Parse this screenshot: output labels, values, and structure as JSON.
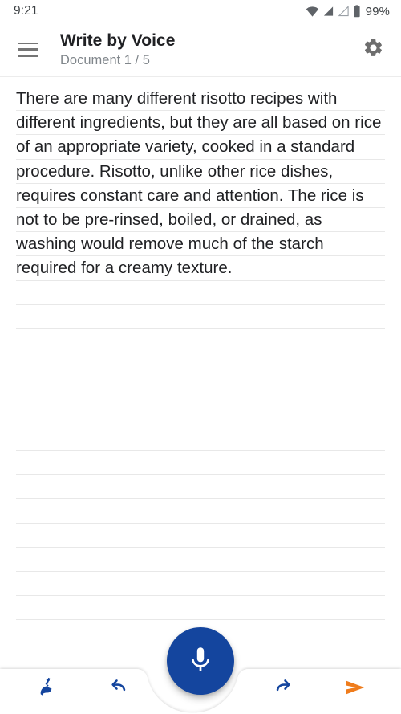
{
  "status_bar": {
    "time": "9:21",
    "battery_percent": "99%",
    "icons": [
      "wifi-icon",
      "signal-filled-icon",
      "signal-outline-icon",
      "battery-icon"
    ]
  },
  "app_bar": {
    "menu_icon": "hamburger-menu-icon",
    "title": "Write by Voice",
    "subtitle": "Document 1 / 5",
    "settings_icon": "gear-icon"
  },
  "document": {
    "text": "There are many different risotto recipes with different ingredients, but they are all based on rice of an appropriate variety, cooked in a standard procedure. Risotto, unlike other rice dishes, requires constant care and attention. The rice is not to be pre-rinsed, boiled, or drained, as washing would remove much of the starch required for a creamy texture.",
    "ruled_line_count": 22,
    "ruled_line_spacing": 30.2,
    "ruled_line_color": "#e8e8e8"
  },
  "bottom_bar": {
    "actions": [
      {
        "name": "clear-button",
        "icon": "broom-icon",
        "color": "#14459E"
      },
      {
        "name": "undo-button",
        "icon": "undo-arrow-icon",
        "color": "#14459E"
      },
      {
        "name": "redo-button",
        "icon": "redo-arrow-icon",
        "color": "#14459E"
      },
      {
        "name": "send-button",
        "icon": "send-arrow-icon",
        "color": "#EF7C1C"
      }
    ]
  },
  "fab": {
    "name": "record-voice-button",
    "icon": "microphone-icon",
    "background": "#14459E",
    "icon_color": "#ffffff"
  },
  "colors": {
    "primary_blue": "#14459E",
    "accent_orange": "#EF7C1C",
    "text_primary": "#202124",
    "text_secondary": "#80868b",
    "icon_gray": "#757575",
    "rule_line": "#e8e8e8",
    "divider": "#ececec",
    "background": "#ffffff"
  }
}
